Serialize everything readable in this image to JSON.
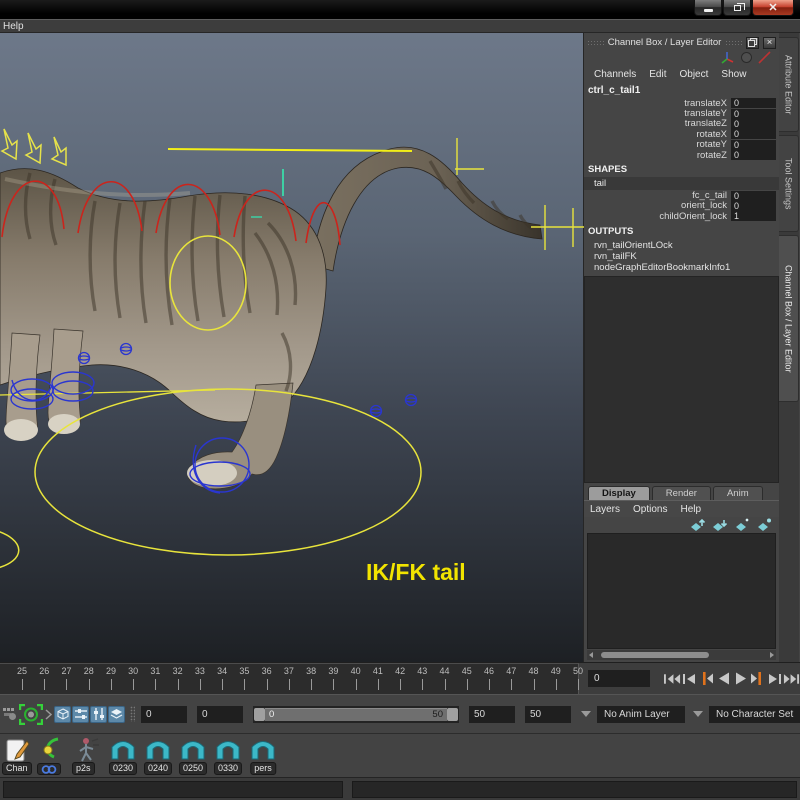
{
  "window": {
    "controls": {
      "minimize": "minimize",
      "restore": "restore",
      "close": "close"
    }
  },
  "menubar": {
    "items": [
      "Help"
    ]
  },
  "viewport": {
    "annotation": "IK/FK tail",
    "palette": {
      "annotation_yellow": "#f2e400",
      "rig_yellow": "#e8e43c",
      "rig_red": "#cb241c",
      "rig_blue": "#2a36d0",
      "rig_cyan": "#3ed0a4"
    }
  },
  "channel_box": {
    "title": "Channel Box / Layer Editor",
    "menus": [
      "Channels",
      "Edit",
      "Object",
      "Show"
    ],
    "corner_icons": [
      "axis-gizmo-icon",
      "sphere-icon",
      "line-icon"
    ],
    "node": "ctrl_c_tail1",
    "attributes": [
      {
        "label": "translateX",
        "value": "0"
      },
      {
        "label": "translateY",
        "value": "0"
      },
      {
        "label": "translateZ",
        "value": "0"
      },
      {
        "label": "rotateX",
        "value": "0"
      },
      {
        "label": "rotateY",
        "value": "0"
      },
      {
        "label": "rotateZ",
        "value": "0"
      }
    ],
    "shapes_header": "SHAPES",
    "shape_node": "tail",
    "shape_attributes": [
      {
        "label": "fc_c_tail",
        "value": "0"
      },
      {
        "label": "orient_lock",
        "value": "0"
      },
      {
        "label": "childOrient_lock",
        "value": "1"
      }
    ],
    "outputs_header": "OUTPUTS",
    "outputs": [
      "rvn_tailOrientLOck",
      "rvn_tailFK",
      "nodeGraphEditorBookmarkInfo1"
    ]
  },
  "layer_editor": {
    "tabs": [
      {
        "label": "Display",
        "active": true
      },
      {
        "label": "Render",
        "active": false
      },
      {
        "label": "Anim",
        "active": false
      }
    ],
    "menus": [
      "Layers",
      "Options",
      "Help"
    ],
    "icons": [
      "move-layer-up",
      "move-layer-down",
      "create-empty-layer",
      "create-layer-from-selected"
    ]
  },
  "side_tabs": [
    {
      "label": "Attribute Editor",
      "active": false
    },
    {
      "label": "Tool Settings",
      "active": false
    },
    {
      "label": "Channel Box / Layer Editor",
      "active": true
    }
  ],
  "timeline": {
    "start": 25,
    "end": 50,
    "current_frame": "0"
  },
  "playback_buttons": [
    "go-to-start",
    "step-back-one-frame",
    "step-back-one-key",
    "play-backwards",
    "play-forwards",
    "step-forward-one-key",
    "step-forward-one-frame",
    "go-to-end"
  ],
  "range_bar": {
    "animation_start": "0",
    "playback_start": "0",
    "slider_start_label": "0",
    "slider_end_label": "50",
    "playback_end": "50",
    "animation_end": "50",
    "anim_layer": "No Anim Layer",
    "character_set": "No Character Set"
  },
  "shelf": {
    "chan_label": "Chan",
    "p2s_label": "p2s",
    "bookmarks": [
      "0230",
      "0240",
      "0250",
      "0330",
      "pers"
    ]
  },
  "command_line": {
    "input": "",
    "result": ""
  }
}
